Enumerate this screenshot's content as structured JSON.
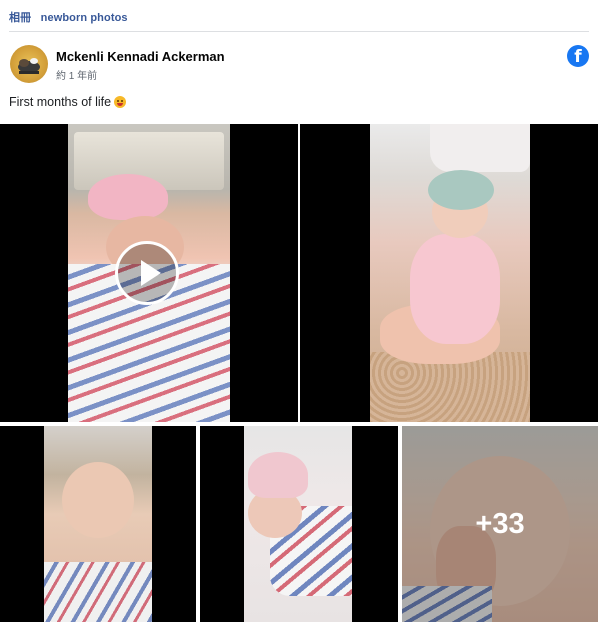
{
  "breadcrumb": {
    "album": "相冊",
    "name": "newborn photos"
  },
  "post": {
    "author": "Mckenli Kennadi Ackerman",
    "timestamp": "約 1 年前",
    "caption": "First months of life"
  },
  "icons": {
    "brand": "facebook-icon",
    "play": "play-icon",
    "emoji": "smiling-face-emoji"
  },
  "colors": {
    "link": "#385898",
    "brand": "#1877f2"
  },
  "gallery": {
    "more_count": "+33"
  }
}
